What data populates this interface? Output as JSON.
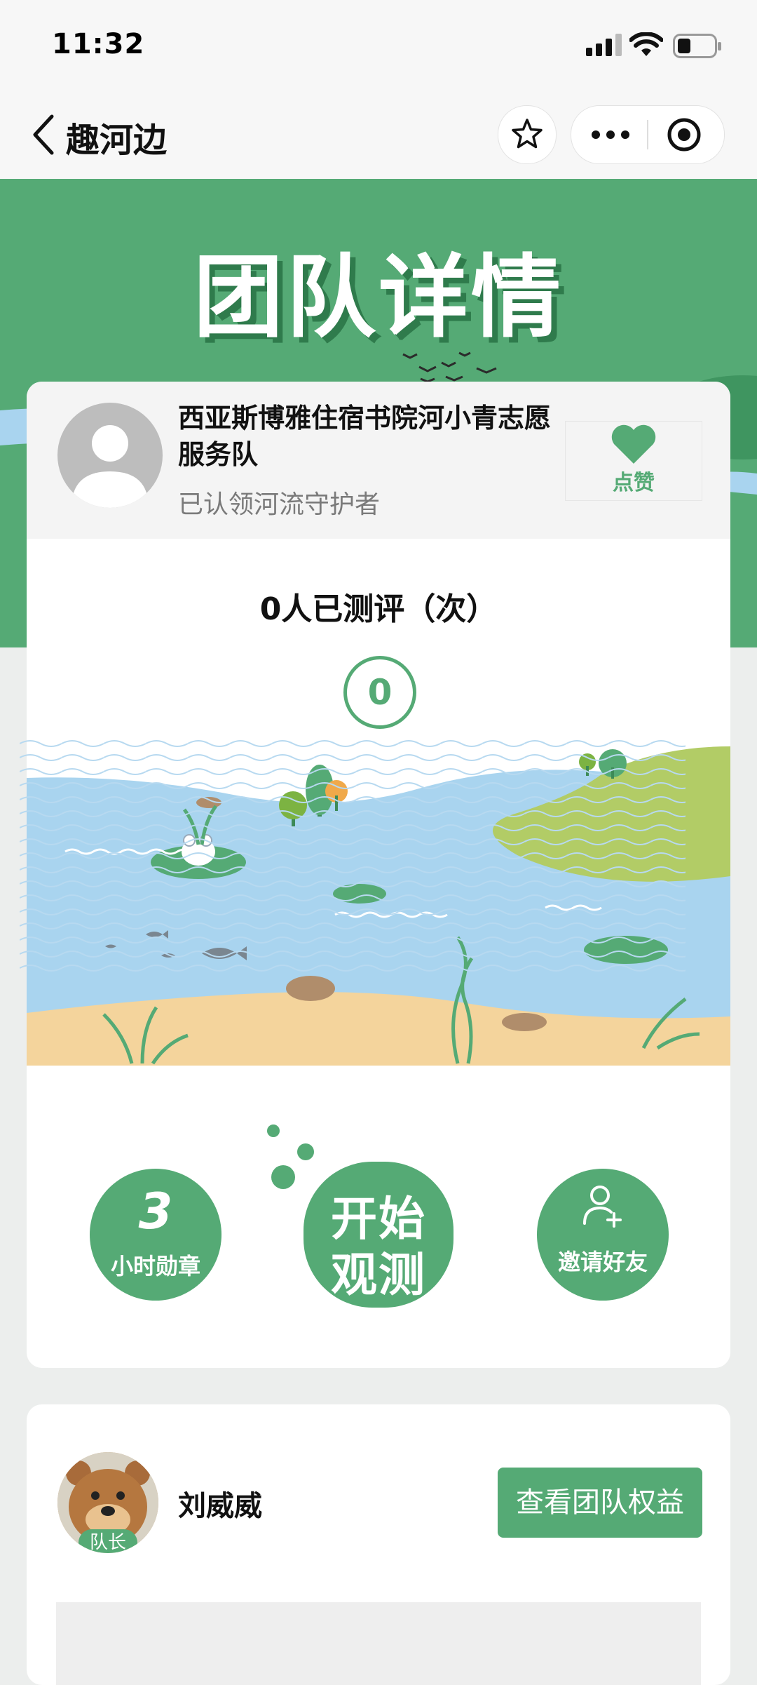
{
  "status_bar": {
    "time": "11:32"
  },
  "nav": {
    "title": "趣河边"
  },
  "hero": {
    "title": "团队详情"
  },
  "team": {
    "name": "西亚斯博雅住宿书院河小青志愿服务队",
    "subtitle": "已认领河流守护者",
    "like_label": "点赞"
  },
  "evaluation": {
    "text": "0人已测评（次）",
    "count": "0"
  },
  "actions": {
    "badge_count": "3",
    "badge_label": "小时勋章",
    "start_line1": "开始",
    "start_line2": "观测",
    "invite_label": "邀请好友"
  },
  "leader": {
    "tag": "队长",
    "name": "刘威威",
    "rights_button": "查看团队权益"
  },
  "colors": {
    "brand_green": "#55aa75",
    "water": "#a9d4ef",
    "sand": "#f4d49c",
    "grass": "#b2cc66"
  }
}
